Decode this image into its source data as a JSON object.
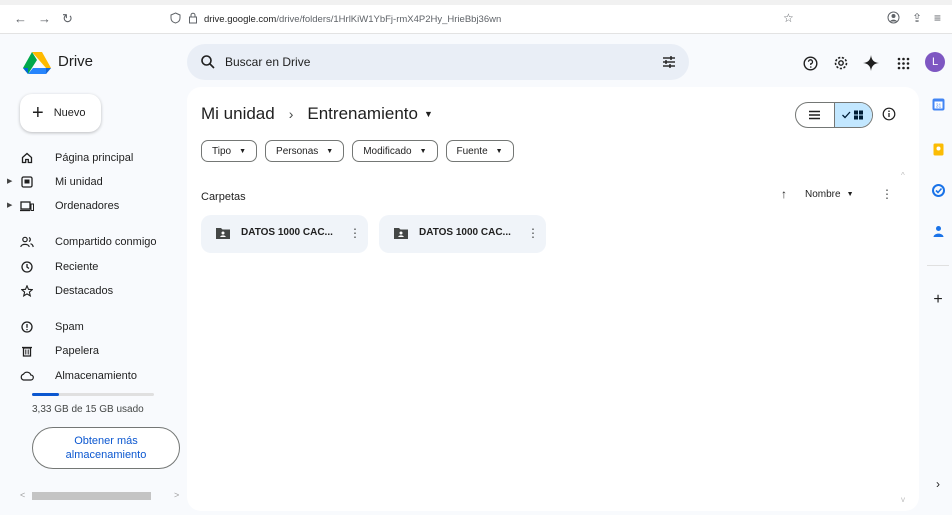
{
  "browser": {
    "url_host": "drive.google.com",
    "url_path": "/drive/folders/1HrlKiW1YbFj-rmX4P2Hy_HrieBbj36wn"
  },
  "header": {
    "app_name": "Drive",
    "search_placeholder": "Buscar en Drive",
    "avatar_letter": "L"
  },
  "sidebar": {
    "new_label": "Nuevo",
    "items": [
      {
        "label": "Página principal",
        "icon": "home-icon"
      },
      {
        "label": "Mi unidad",
        "icon": "my-drive-icon"
      },
      {
        "label": "Ordenadores",
        "icon": "computers-icon"
      },
      {
        "label": "Compartido conmigo",
        "icon": "shared-icon"
      },
      {
        "label": "Reciente",
        "icon": "recent-icon"
      },
      {
        "label": "Destacados",
        "icon": "star-icon"
      },
      {
        "label": "Spam",
        "icon": "spam-icon"
      },
      {
        "label": "Papelera",
        "icon": "trash-icon"
      },
      {
        "label": "Almacenamiento",
        "icon": "cloud-icon"
      }
    ],
    "storage_text": "3,33 GB de 15 GB usado",
    "storage_fraction": 0.22,
    "more_storage_label": "Obtener más almacenamiento"
  },
  "main": {
    "breadcrumb_root": "Mi unidad",
    "breadcrumb_current": "Entrenamiento",
    "filters": [
      "Tipo",
      "Personas",
      "Modificado",
      "Fuente"
    ],
    "section_title": "Carpetas",
    "sort_label": "Nombre",
    "folders": [
      {
        "name": "DATOS 1000 CAC..."
      },
      {
        "name": "DATOS 1000 CAC..."
      }
    ]
  },
  "colors": {
    "accent": "#0b57d0",
    "avatar": "#7e57c2",
    "toggle_active": "#c2e7ff"
  }
}
